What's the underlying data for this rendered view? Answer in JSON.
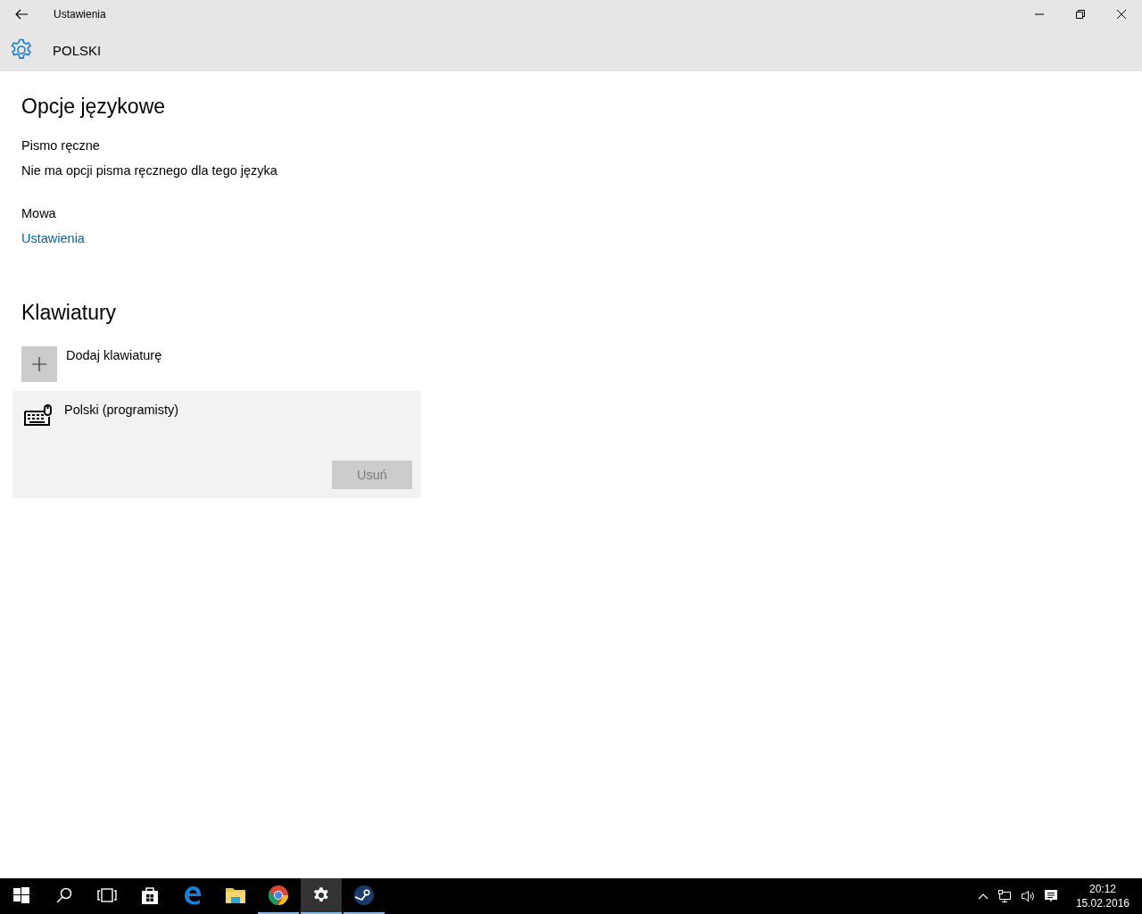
{
  "window": {
    "title": "Ustawienia"
  },
  "header": {
    "title": "POLSKI"
  },
  "page_title": "Opcje językowe",
  "handwriting": {
    "label": "Pismo ręczne",
    "text": "Nie ma opcji pisma ręcznego dla tego języka"
  },
  "speech": {
    "label": "Mowa",
    "link": "Ustawienia"
  },
  "keyboards": {
    "title": "Klawiatury",
    "add_label": "Dodaj klawiaturę",
    "items": [
      {
        "name": "Polski (programisty)",
        "selected": true,
        "remove_button": {
          "label": "Usuń",
          "disabled": true
        }
      }
    ]
  },
  "taskbar": {
    "apps": [
      {
        "kind": "start",
        "running": false,
        "active": false
      },
      {
        "kind": "search",
        "running": false,
        "active": false
      },
      {
        "kind": "taskview",
        "running": false,
        "active": false
      },
      {
        "kind": "store",
        "running": false,
        "active": false
      },
      {
        "kind": "edge",
        "running": false,
        "active": false
      },
      {
        "kind": "explorer",
        "running": false,
        "active": false
      },
      {
        "kind": "chrome",
        "running": true,
        "active": false
      },
      {
        "kind": "settings",
        "running": true,
        "active": true
      },
      {
        "kind": "steam",
        "running": true,
        "active": false
      }
    ],
    "time": "20:12",
    "date": "15.02.2016"
  }
}
